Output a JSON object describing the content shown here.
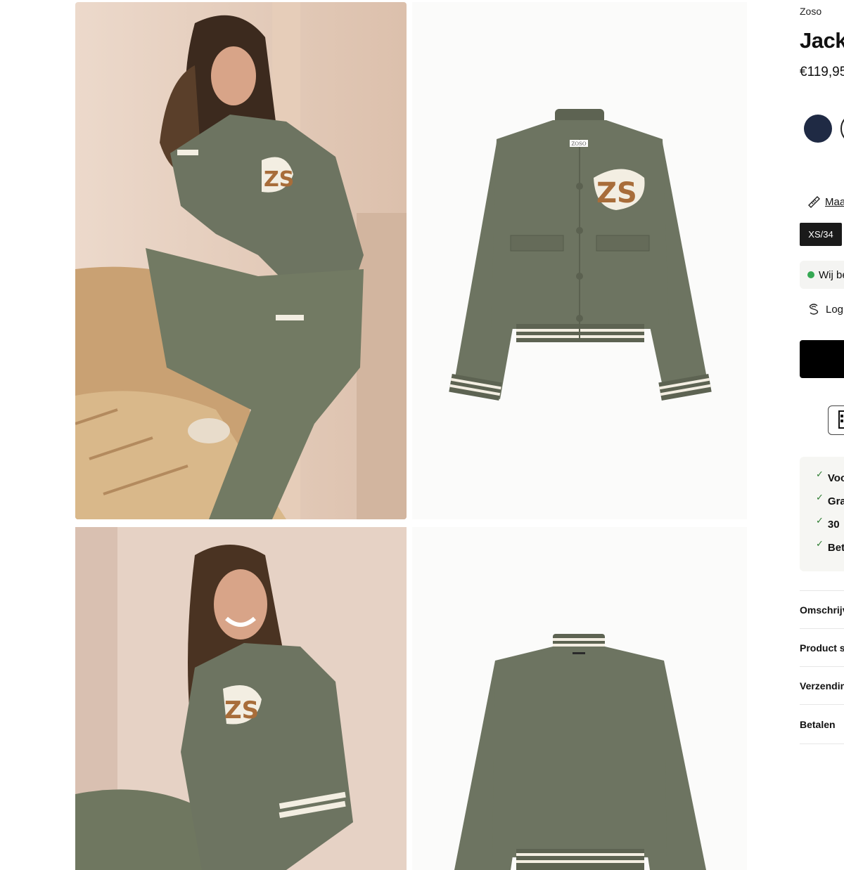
{
  "gallery": {
    "images": [
      {
        "alt": "model-sitting"
      },
      {
        "alt": "jacket-front"
      },
      {
        "alt": "model-laughing"
      },
      {
        "alt": "jacket-back"
      }
    ],
    "patch_text": "ZS",
    "label_text": "ZOSO"
  },
  "product": {
    "brand": "Zoso",
    "title": "Jacke",
    "price": "€119,95",
    "colors": [
      {
        "name": "navy",
        "hex": "#1f2a44"
      },
      {
        "name": "green",
        "hex": "#ffffff"
      }
    ],
    "size_guide_label": "Maa",
    "sizes": [
      "XS/34"
    ],
    "stock_text": "Wij be",
    "login_text": "Log",
    "usps": [
      "Voo",
      "Gra",
      "30",
      "Bet"
    ],
    "accordion": [
      "Omschrijv",
      "Product sp",
      "Verzendin",
      "Betalen"
    ]
  },
  "colors": {
    "jacket": "#6d7461",
    "stripe": "#f3eee2",
    "patch_brown": "#a86d3a",
    "stock_green": "#35a853"
  }
}
